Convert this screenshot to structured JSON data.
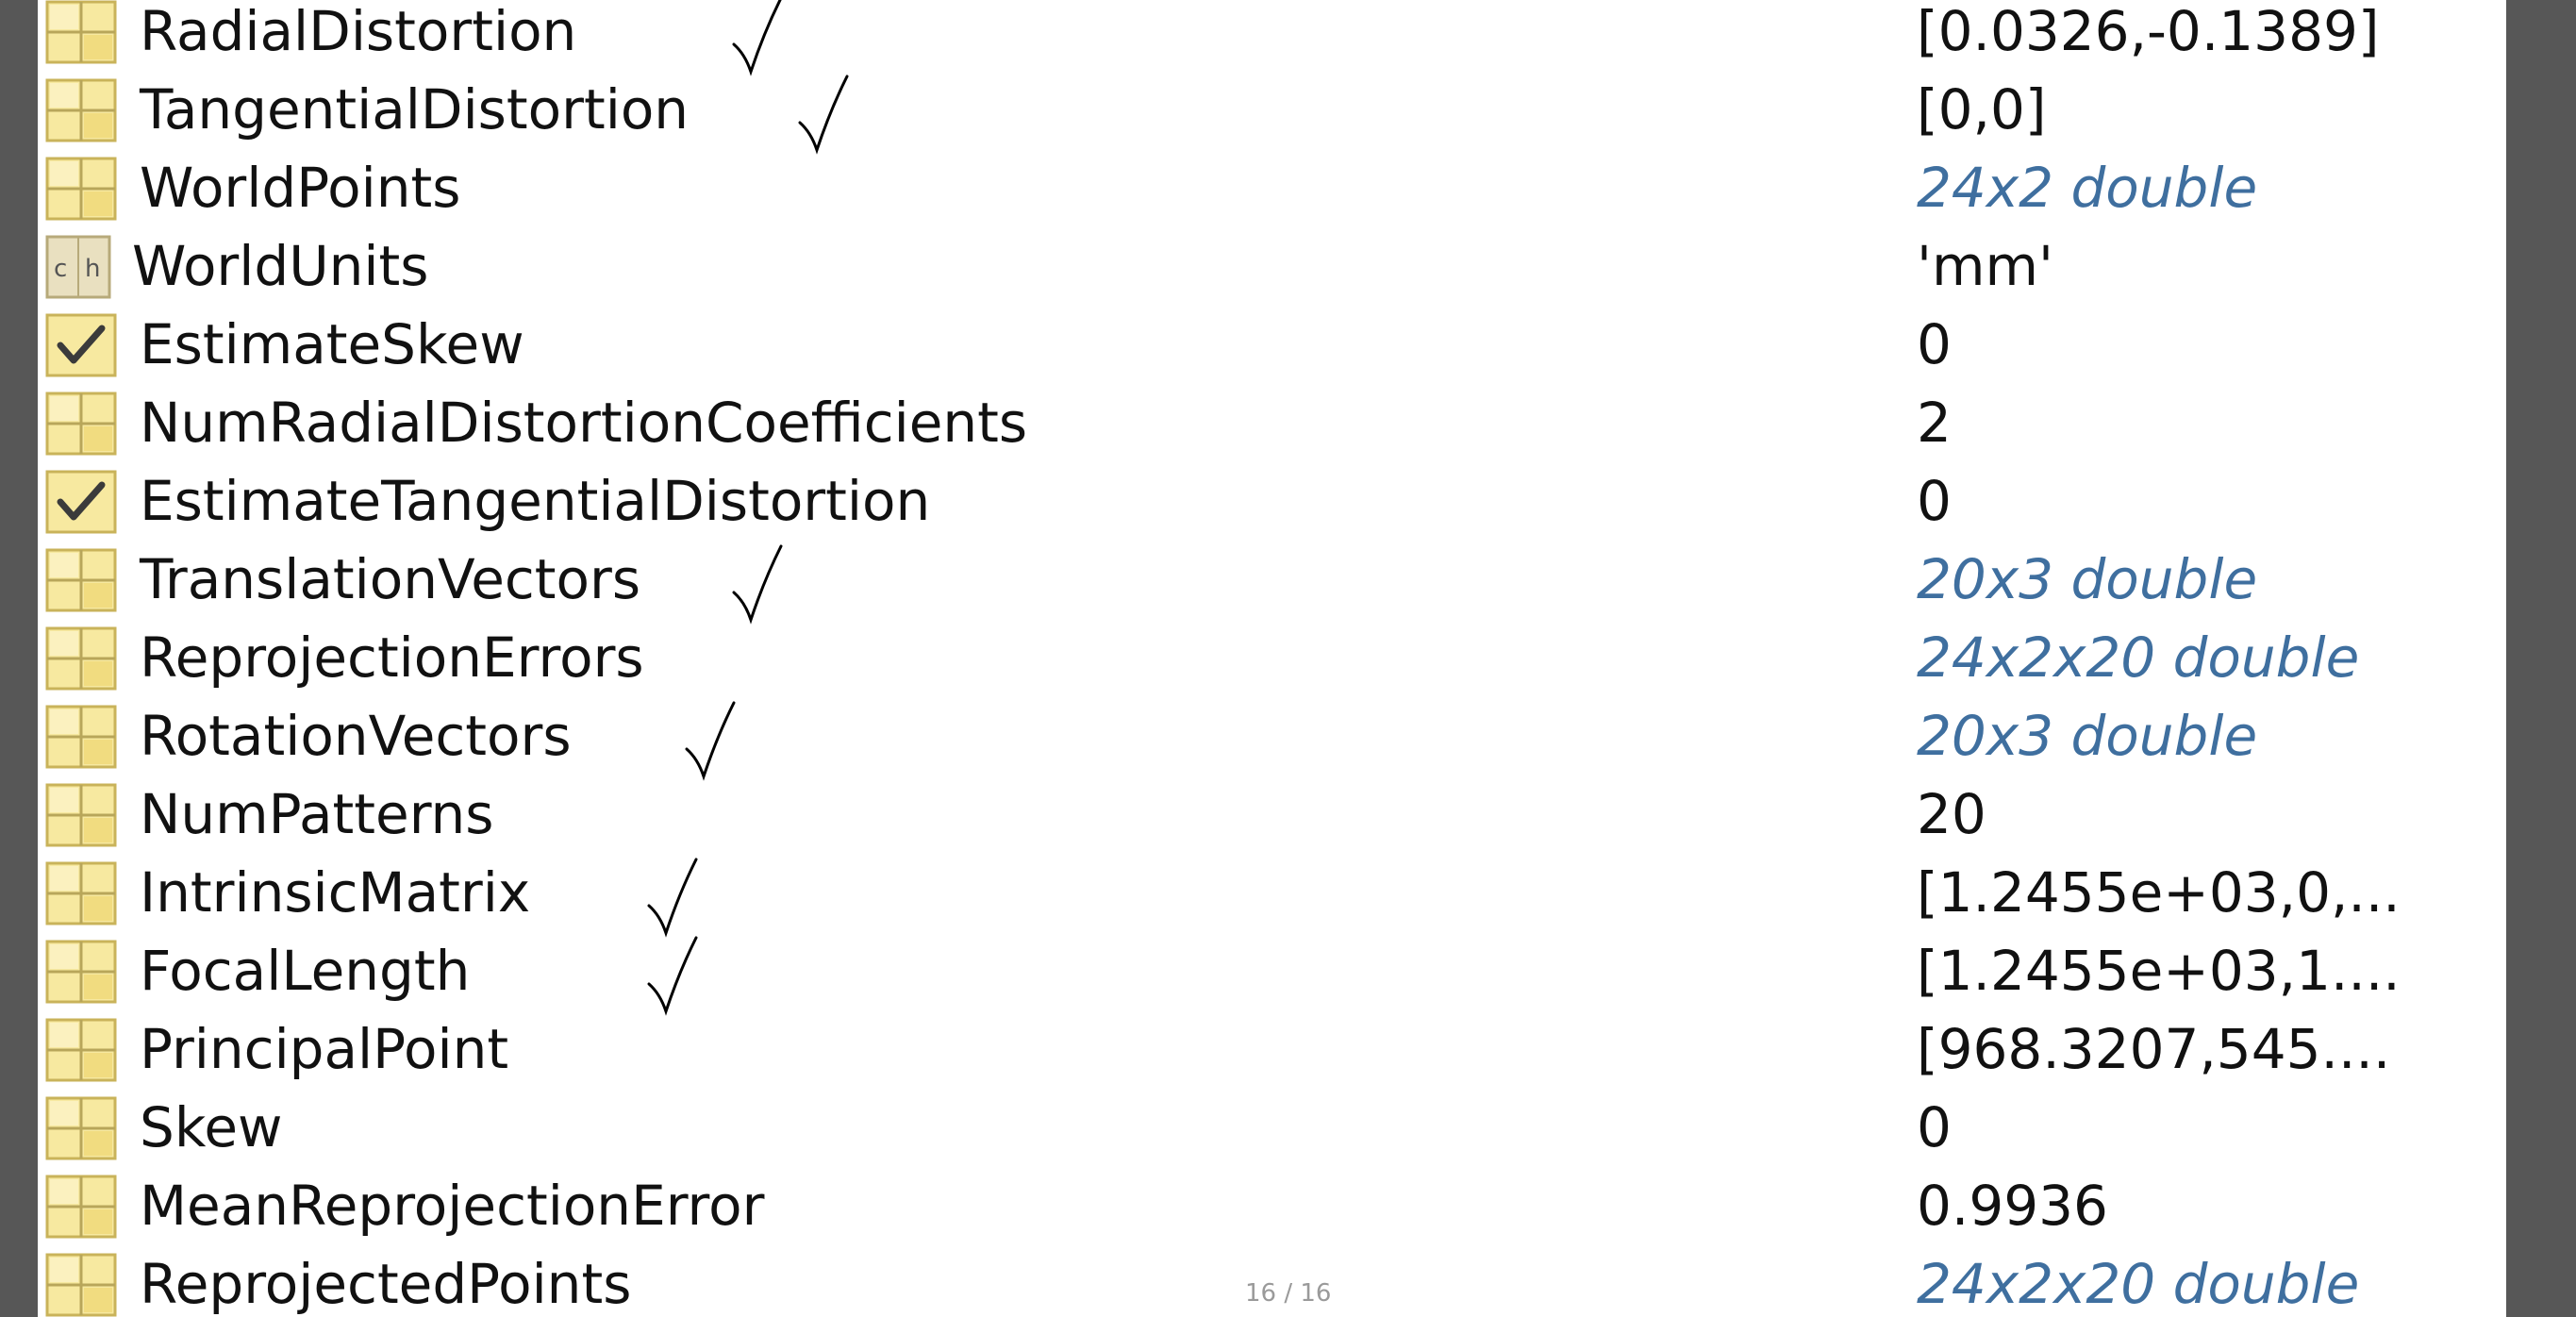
{
  "rows": [
    {
      "name": "RadialDistortion",
      "value": "[0.0326,-0.1389]",
      "icon": "matrix-icon",
      "link": false,
      "tick": true
    },
    {
      "name": "TangentialDistortion",
      "value": "[0,0]",
      "icon": "matrix-icon",
      "link": false,
      "tick": true
    },
    {
      "name": "WorldPoints",
      "value": "24x2 double",
      "icon": "matrix-icon",
      "link": true,
      "tick": false
    },
    {
      "name": "WorldUnits",
      "value": "'mm'",
      "icon": "char-icon",
      "link": false,
      "tick": false
    },
    {
      "name": "EstimateSkew",
      "value": "0",
      "icon": "checkbox-icon",
      "link": false,
      "tick": false
    },
    {
      "name": "NumRadialDistortionCoefficients",
      "value": "2",
      "icon": "matrix-icon",
      "link": false,
      "tick": false
    },
    {
      "name": "EstimateTangentialDistortion",
      "value": "0",
      "icon": "checkbox-icon",
      "link": false,
      "tick": false
    },
    {
      "name": "TranslationVectors",
      "value": "20x3 double",
      "icon": "matrix-icon",
      "link": true,
      "tick": true
    },
    {
      "name": "ReprojectionErrors",
      "value": "24x2x20 double",
      "icon": "matrix-icon",
      "link": true,
      "tick": false
    },
    {
      "name": "RotationVectors",
      "value": "20x3 double",
      "icon": "matrix-icon",
      "link": true,
      "tick": true
    },
    {
      "name": "NumPatterns",
      "value": "20",
      "icon": "matrix-icon",
      "link": false,
      "tick": false
    },
    {
      "name": "IntrinsicMatrix",
      "value": "[1.2455e+03,0,...",
      "icon": "matrix-icon",
      "link": false,
      "tick": true
    },
    {
      "name": "FocalLength",
      "value": "[1.2455e+03,1....",
      "icon": "matrix-icon",
      "link": false,
      "tick": true
    },
    {
      "name": "PrincipalPoint",
      "value": "[968.3207,545....",
      "icon": "matrix-icon",
      "link": false,
      "tick": false
    },
    {
      "name": "Skew",
      "value": "0",
      "icon": "matrix-icon",
      "link": false,
      "tick": false
    },
    {
      "name": "MeanReprojectionError",
      "value": "0.9936",
      "icon": "matrix-icon",
      "link": false,
      "tick": false
    },
    {
      "name": "ReprojectedPoints",
      "value": "24x2x20 double",
      "icon": "matrix-icon",
      "link": true,
      "tick": false
    }
  ],
  "page_indicator": "16 / 16",
  "colors": {
    "link": "#3f6f9f",
    "text": "#111111",
    "frame": "#575757",
    "icon_fill": "#f7e9a0",
    "icon_border": "#c9b35a"
  }
}
